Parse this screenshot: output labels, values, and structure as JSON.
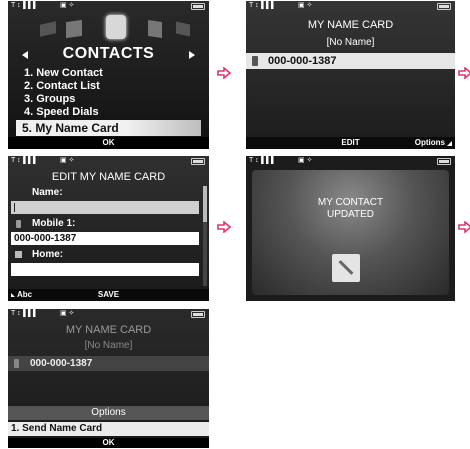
{
  "status": {
    "signal": "T ↕▐▐▐",
    "icons": "▣ ✧"
  },
  "screen1": {
    "title": "CONTACTS",
    "items": [
      "1. New Contact",
      "2. Contact List",
      "3. Groups",
      "4. Speed Dials",
      "5. My Name Card"
    ],
    "selected_index": 4,
    "softkey_center": "OK"
  },
  "screen2": {
    "title": "MY NAME CARD",
    "subtitle": "[No Name]",
    "number": "000-000-1387",
    "softkey_center": "EDIT",
    "softkey_right": "Options"
  },
  "screen3": {
    "title": "EDIT MY NAME CARD",
    "name_label": "Name:",
    "mobile_label": "Mobile 1:",
    "mobile_value": "000-000-1387",
    "home_label": "Home:",
    "softkey_left": "Abc",
    "softkey_center": "SAVE"
  },
  "screen4": {
    "message_line1": "MY CONTACT",
    "message_line2": "UPDATED"
  },
  "screen5": {
    "title": "MY NAME CARD",
    "subtitle": "[No Name]",
    "number": "000-000-1387",
    "options_title": "Options",
    "option_item": "1.  Send Name Card",
    "softkey_center": "OK"
  },
  "colors": {
    "arrow": "#e0356f",
    "highlight": "#e8e8e8",
    "accent": "#3a3a3a"
  }
}
